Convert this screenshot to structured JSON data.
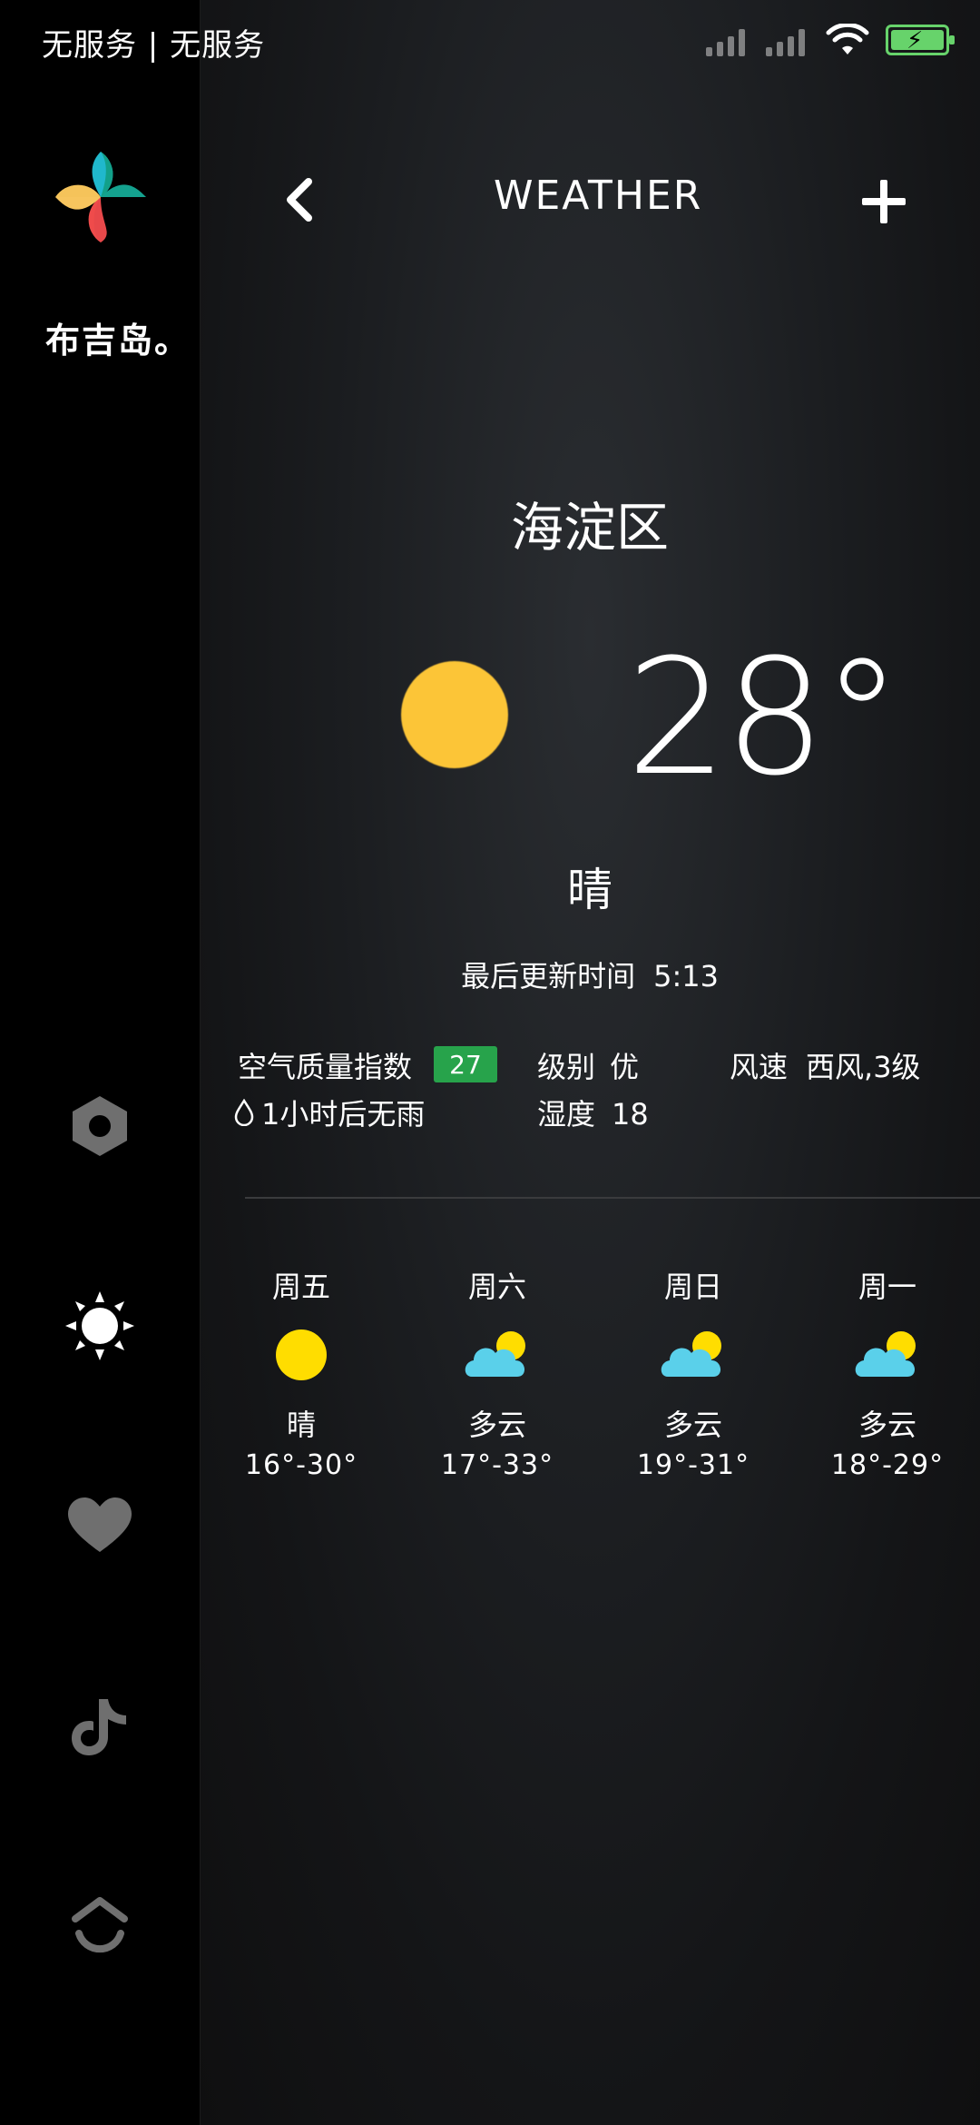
{
  "status_bar": {
    "carrier_text": "无服务 | 无服务"
  },
  "sidebar": {
    "brand": "布吉岛。",
    "icons": [
      "hex-nut-icon",
      "sun-icon",
      "heart-icon",
      "tiktok-icon",
      "home-up-icon"
    ]
  },
  "header": {
    "title": "WEATHER"
  },
  "current": {
    "district": "海淀区",
    "temperature": "28°",
    "condition": "晴",
    "updated_label": "最后更新时间",
    "updated_time": "5:13",
    "aqi_label": "空气质量指数",
    "aqi_value": "27",
    "level_label": "级别",
    "level_value": "优",
    "wind_label": "风速",
    "wind_value": "西风,3级",
    "rain_text": "1小时后无雨",
    "humidity_label": "湿度",
    "humidity_value": "18"
  },
  "forecast": [
    {
      "day": "周五",
      "condition": "晴",
      "range": "16°-30°",
      "icon": "sun-icon"
    },
    {
      "day": "周六",
      "condition": "多云",
      "range": "17°-33°",
      "icon": "partly-cloudy-icon"
    },
    {
      "day": "周日",
      "condition": "多云",
      "range": "19°-31°",
      "icon": "partly-cloudy-icon"
    },
    {
      "day": "周一",
      "condition": "多云",
      "range": "18°-29°",
      "icon": "partly-cloudy-icon"
    }
  ],
  "colors": {
    "sun": "#fcc537",
    "forecast_sun": "#ffdd00",
    "cloud": "#5ad0ea",
    "aqi_green": "#27a34b",
    "battery_green": "#67d36b"
  }
}
